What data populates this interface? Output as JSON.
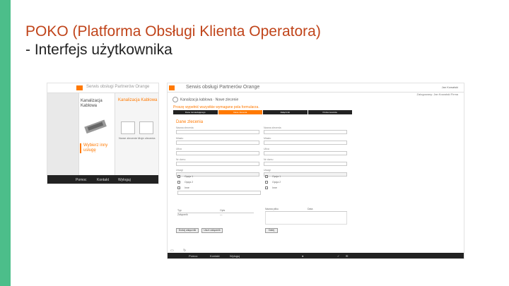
{
  "slide": {
    "title_line1": "POKO (Platforma Obsługi Klienta Operatora)",
    "title_line2": "- Interfejs użytkownika"
  },
  "shot1": {
    "header_title": "Serwis obsługi Partnerów Orange",
    "product_name": "Kanalizacja Kablowa",
    "select_label": "Wybierz inny usługę",
    "panel_title": "Kanalizacja Kablowa",
    "option1_label": "Nowe zlecenie",
    "option2_label": "Moje zlecenia",
    "footer_items": [
      "Pomoc",
      "Kontakt",
      "Wyloguj"
    ]
  },
  "shot2": {
    "app_title": "Serwis obsługi Partnerów Orange",
    "user_info": "Jan Kowalski",
    "user_box": "Zalogowany: Jan Kowalski\nFirma",
    "breadcrumb": "Kanalizacja kablowa · Nowe zlecenie",
    "instruction": "Proszę wypełnić wszystkie wymagane pola formularza.",
    "steps": [
      "Dane zamawiającego",
      "Dane zlecenia",
      "Załączniki",
      "Podsumowanie"
    ],
    "active_step": 1,
    "section_title": "Dane zlecenia",
    "left_fields": [
      {
        "label": "Nazwa zlecenia",
        "value": "",
        "gray": false
      },
      {
        "label": "Miasto",
        "value": "",
        "gray": false
      },
      {
        "label": "Ulica",
        "value": "",
        "gray": false
      },
      {
        "label": "Nr domu",
        "value": "",
        "gray": false
      },
      {
        "label": "Uwagi",
        "value": "",
        "gray": true
      }
    ],
    "right_fields": [
      {
        "label": "Nazwa zlecenia",
        "value": "",
        "gray": false
      },
      {
        "label": "Miasto",
        "value": "",
        "gray": false
      },
      {
        "label": "Ulica",
        "value": "",
        "gray": false
      },
      {
        "label": "Nr domu",
        "value": "",
        "gray": false
      },
      {
        "label": "Uwagi",
        "value": "",
        "gray": true
      }
    ],
    "left_checks": [
      "Opcja 1",
      "Opcja 2",
      "Inne"
    ],
    "right_checks": [
      "Opcja 1",
      "Opcja 2",
      "Inne"
    ],
    "table_headers": [
      "Typ",
      "Opis"
    ],
    "table_rows": [
      [
        "Załącznik",
        "—"
      ]
    ],
    "table2_headers": [
      "Nazwa pliku",
      "Data"
    ],
    "buttons": [
      "Dodaj załącznik",
      "Usuń załącznik",
      "Dalej"
    ],
    "footer_items": [
      "Pomoc",
      "Kontakt",
      "Wyloguj"
    ]
  }
}
